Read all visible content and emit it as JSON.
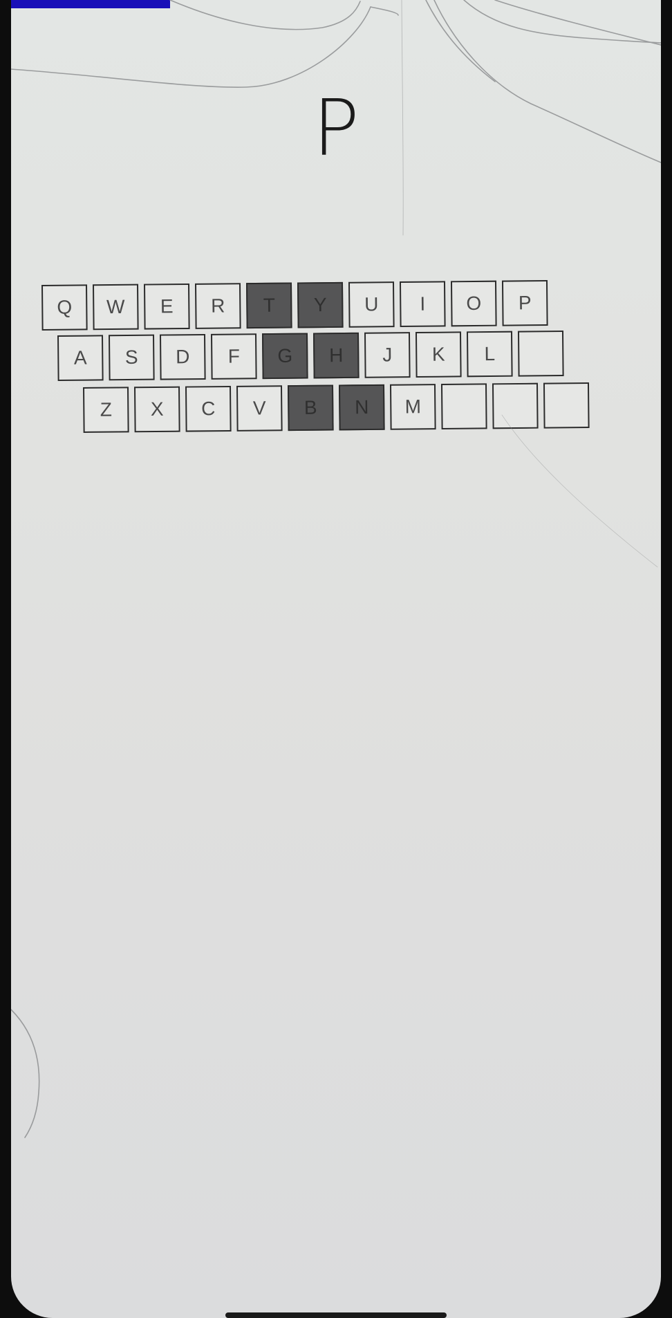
{
  "target": {
    "letter": "P"
  },
  "keyboard": {
    "rows": [
      [
        {
          "label": "Q",
          "dark": false
        },
        {
          "label": "W",
          "dark": false
        },
        {
          "label": "E",
          "dark": false
        },
        {
          "label": "R",
          "dark": false
        },
        {
          "label": "T",
          "dark": true
        },
        {
          "label": "Y",
          "dark": true
        },
        {
          "label": "U",
          "dark": false
        },
        {
          "label": "I",
          "dark": false
        },
        {
          "label": "O",
          "dark": false
        },
        {
          "label": "P",
          "dark": false
        }
      ],
      [
        {
          "label": "A",
          "dark": false
        },
        {
          "label": "S",
          "dark": false
        },
        {
          "label": "D",
          "dark": false
        },
        {
          "label": "F",
          "dark": false
        },
        {
          "label": "G",
          "dark": true
        },
        {
          "label": "H",
          "dark": true
        },
        {
          "label": "J",
          "dark": false
        },
        {
          "label": "K",
          "dark": false
        },
        {
          "label": "L",
          "dark": false
        },
        {
          "label": "",
          "dark": false
        }
      ],
      [
        {
          "label": "Z",
          "dark": false
        },
        {
          "label": "X",
          "dark": false
        },
        {
          "label": "C",
          "dark": false
        },
        {
          "label": "V",
          "dark": false
        },
        {
          "label": "B",
          "dark": true
        },
        {
          "label": "N",
          "dark": true
        },
        {
          "label": "M",
          "dark": false
        },
        {
          "label": "",
          "dark": false
        },
        {
          "label": "",
          "dark": false
        },
        {
          "label": "",
          "dark": false
        }
      ]
    ]
  },
  "colors": {
    "screen_background": "#e1e2e0",
    "key_background": "#e6e7e5",
    "key_dark_background": "#555556",
    "key_border": "#2b2b2b",
    "status_accent": "#1a0fb8"
  }
}
